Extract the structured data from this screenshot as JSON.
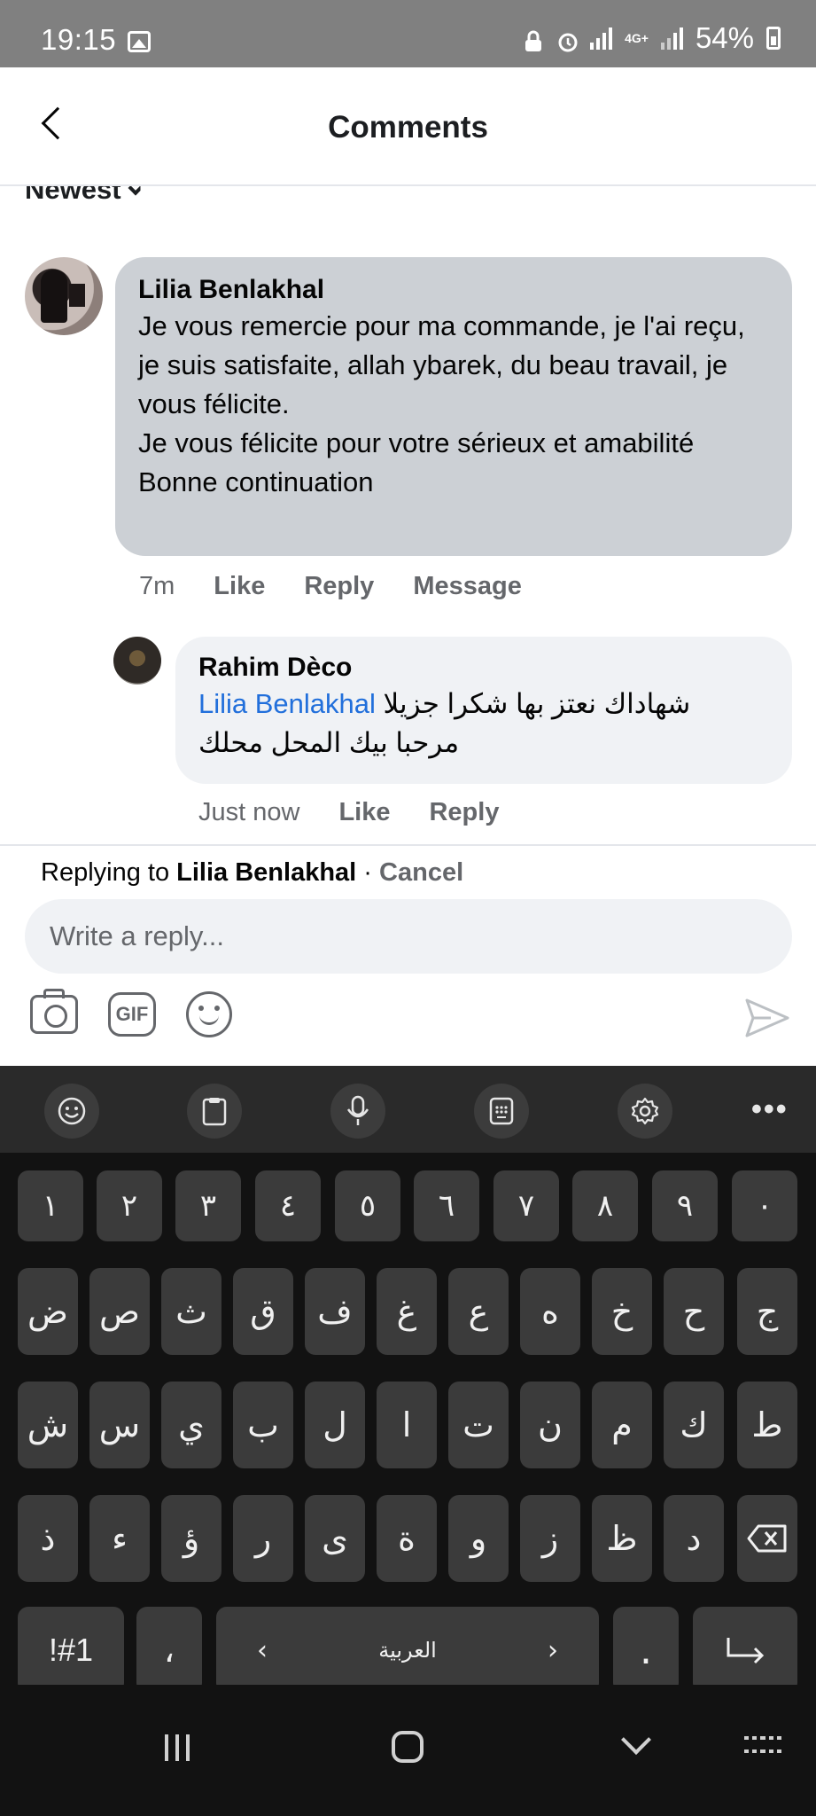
{
  "status_bar": {
    "time": "19:15",
    "battery": "54%",
    "network": "4G+"
  },
  "header": {
    "title": "Comments"
  },
  "sort": {
    "label": "Newest"
  },
  "comments": [
    {
      "author": "Lilia Benlakhal",
      "text": "Je vous remercie pour ma commande, je l'ai reçu, je suis satisfaite, allah ybarek, du beau travail, je vous félicite.\nJe vous félicite pour votre sérieux et amabilité\nBonne continuation",
      "time": "7m",
      "actions": [
        "Like",
        "Reply",
        "Message"
      ]
    }
  ],
  "reply": {
    "author": "Rahim Dèco",
    "mention": "Lilia Benlakhal",
    "text_line1": "شهاداك نعتز بها شكرا جزيلا",
    "text_line2": "مرحبا بيك المحل محلك",
    "time": "Just now",
    "actions": [
      "Like",
      "Reply"
    ]
  },
  "replying_bar": {
    "prefix": "Replying to",
    "name": "Lilia Benlakhal",
    "separator": "·",
    "cancel": "Cancel"
  },
  "reply_input": {
    "placeholder": "Write a reply...",
    "value": ""
  },
  "composer": {
    "gif_label": "GIF"
  },
  "keyboard": {
    "toolbar": {
      "more": "•••"
    },
    "row_numbers": [
      "١",
      "٢",
      "٣",
      "٤",
      "٥",
      "٦",
      "٧",
      "٨",
      "٩",
      "٠"
    ],
    "row1": [
      "ض",
      "ص",
      "ث",
      "ق",
      "ف",
      "غ",
      "ع",
      "ه",
      "خ",
      "ح",
      "ج"
    ],
    "row2": [
      "ش",
      "س",
      "ي",
      "ب",
      "ل",
      "ا",
      "ت",
      "ن",
      "م",
      "ك",
      "ط"
    ],
    "row3": [
      "ذ",
      "ء",
      "ؤ",
      "ر",
      "ى",
      "ة",
      "و",
      "ز",
      "ظ",
      "د"
    ],
    "symbols_key": "!#1",
    "comma_key": "،",
    "space_label": "العربية",
    "period_key": "."
  }
}
